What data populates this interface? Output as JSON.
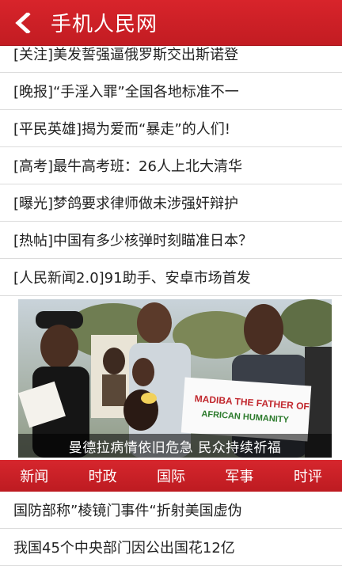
{
  "header": {
    "back_icon": "chevron-left-icon",
    "title": "手机人民网",
    "bg_color": "#d8242b"
  },
  "news_list": [
    "[关注]美发誓强逼俄罗斯交出斯诺登",
    "[晚报]“手淫入罪”全国各地标准不一",
    "[平民英雄]揭为爱而“暴走”的人们!",
    "[高考]最牛高考班：26人上北大清华",
    "[曝光]梦鸽要求律师做未涉强奸辩护",
    "[热帖]中国有多少核弹时刻瞄准日本？",
    "[人民新闻2.0]91助手、安卓市场首发"
  ],
  "photo": {
    "caption": "曼德拉病情依旧危急 民众持续祈福",
    "sign_line1": "MADIBA THE FATHER OF",
    "sign_line2": "AFRICAN HUMANITY"
  },
  "tabs": [
    "新闻",
    "时政",
    "国际",
    "军事",
    "时评"
  ],
  "bottom_list": [
    "国防部称”棱镜门事件“折射美国虚伪",
    "我国45个中央部门因公出国花12亿"
  ]
}
